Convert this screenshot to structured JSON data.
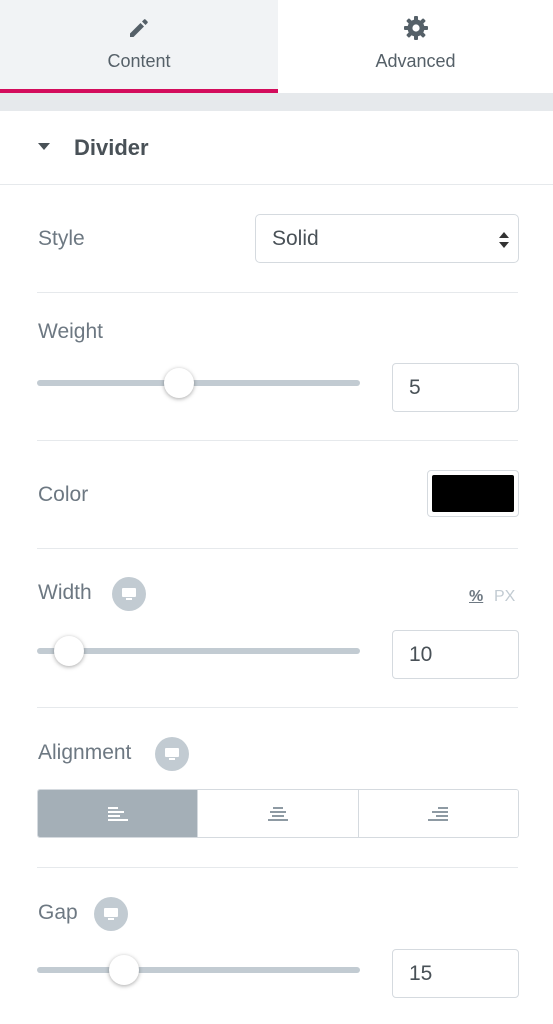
{
  "tabs": {
    "content": {
      "label": "Content",
      "icon": "pencil-icon",
      "active": true
    },
    "advanced": {
      "label": "Advanced",
      "icon": "gear-icon"
    }
  },
  "colors": {
    "accent": "#d30c5c",
    "text": "#6d7882",
    "track": "#c2cbd2",
    "active_choice": "#a4afb7"
  },
  "section": {
    "title": "Divider",
    "expanded": true
  },
  "controls": {
    "style": {
      "label": "Style",
      "value": "Solid",
      "icon": "select-arrows-icon"
    },
    "weight": {
      "label": "Weight",
      "value": "5",
      "slider_fraction": 0.44
    },
    "color": {
      "label": "Color",
      "value": "#000000"
    },
    "width": {
      "label": "Width",
      "value": "10",
      "units": [
        "%",
        "PX"
      ],
      "active_unit": "%",
      "slider_fraction": 0.1,
      "responsive_icon": "desktop-icon"
    },
    "alignment": {
      "label": "Alignment",
      "responsive_icon": "desktop-icon",
      "options": [
        {
          "name": "left",
          "icon": "align-left-icon",
          "active": true
        },
        {
          "name": "center",
          "icon": "align-center-icon",
          "active": false
        },
        {
          "name": "right",
          "icon": "align-right-icon",
          "active": false
        }
      ]
    },
    "gap": {
      "label": "Gap",
      "value": "15",
      "slider_fraction": 0.27,
      "responsive_icon": "desktop-icon"
    }
  }
}
